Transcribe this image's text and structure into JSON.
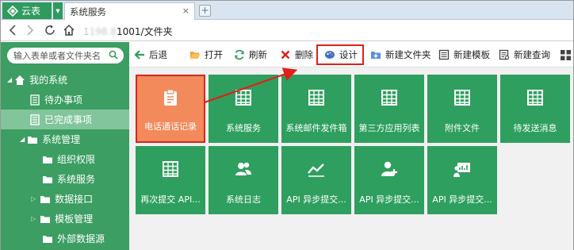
{
  "browser": {
    "app_name": "云表",
    "tab_title": "系统服务",
    "tab_close": "×",
    "new_tab": "+",
    "url_blurred": "1",
    "url_visible_host": "198.8",
    "url_path": "1001/文件夹"
  },
  "sidebar": {
    "search_placeholder": "输入表单或者文件夹名",
    "items": [
      {
        "label": "我的系统"
      },
      {
        "label": "待办事项"
      },
      {
        "label": "已完成事项"
      },
      {
        "label": "系统管理"
      },
      {
        "label": "组织权限"
      },
      {
        "label": "系统服务"
      },
      {
        "label": "数据接口"
      },
      {
        "label": "模板管理"
      },
      {
        "label": "外部数据源"
      }
    ]
  },
  "toolbar": {
    "back": "后退",
    "open": "打开",
    "refresh": "刷新",
    "delete": "删除",
    "design": "设计",
    "new_folder": "新建文件夹",
    "new_template": "新建模板",
    "new_query": "新建查询"
  },
  "tiles": [
    {
      "label": "电话通话记录",
      "icon": "clipboard-icon"
    },
    {
      "label": "系统服务",
      "icon": "table-icon"
    },
    {
      "label": "系统邮件发件箱",
      "icon": "table-icon"
    },
    {
      "label": "第三方应用列表",
      "icon": "table-icon"
    },
    {
      "label": "附件文件",
      "icon": "table-icon"
    },
    {
      "label": "待发送消息",
      "icon": "table-icon"
    },
    {
      "label": "再次提交 API...",
      "icon": "table-icon"
    },
    {
      "label": "系统日志",
      "icon": "users-icon"
    },
    {
      "label": "API 异步提交...",
      "icon": "trend-icon"
    },
    {
      "label": "API 异步提交...",
      "icon": "add-user-icon"
    },
    {
      "label": "API 异步提交...",
      "icon": "presentation-icon"
    }
  ],
  "colors": {
    "sidebar_bg": "#3c9e62",
    "tile_bg": "#2e9f5e",
    "tile_selected_bg": "#f28a5c",
    "highlight_red": "#e0201a"
  }
}
